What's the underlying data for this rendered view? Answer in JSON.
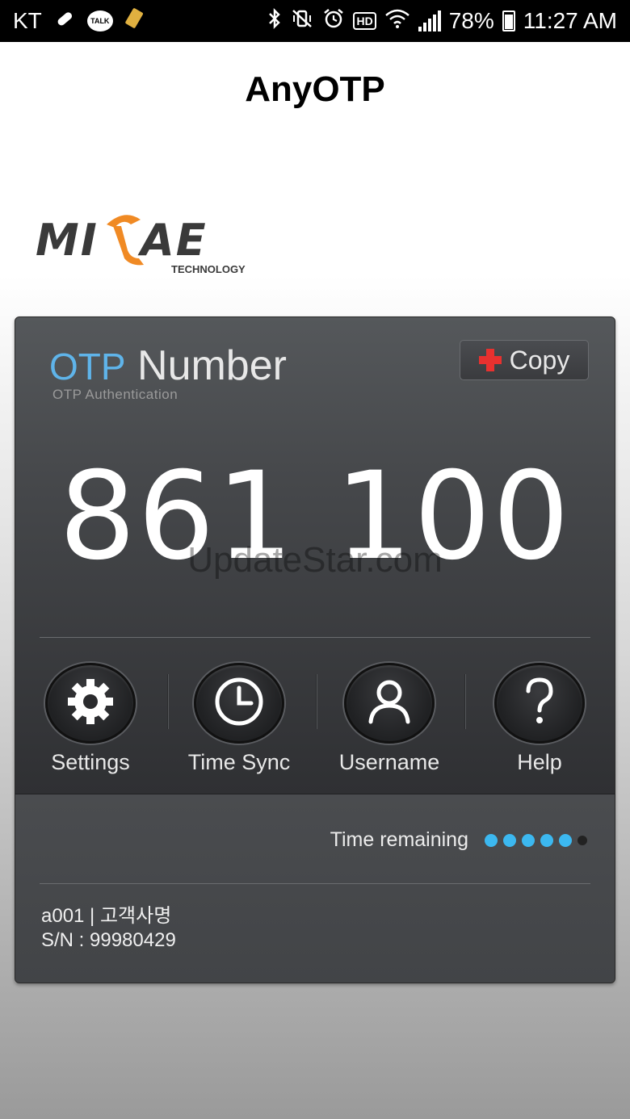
{
  "status_bar": {
    "carrier": "KT",
    "left_icons": [
      "pill-icon",
      "kakaotalk-icon",
      "ticket-icon"
    ],
    "kakao_label": "TALK",
    "right_icons": [
      "bluetooth-icon",
      "vibrate-mute-icon",
      "alarm-icon",
      "hd-icon",
      "wifi-icon",
      "signal-icon",
      "battery-icon"
    ],
    "hd_label": "HD",
    "battery": "78%",
    "time": "11:27 AM"
  },
  "app": {
    "title": "AnyOTP"
  },
  "logo": {
    "text": "MIRAE",
    "subtext": "TECHNOLOGY",
    "accent_color": "#f08a24",
    "dark_color": "#3a3a3a"
  },
  "otp": {
    "title_prefix": "OTP",
    "title_main": "Number",
    "subtitle": "OTP Authentication",
    "copy_label": "Copy",
    "number": "861 100",
    "watermark": "UpdateStar.com"
  },
  "actions": [
    {
      "label": "Settings",
      "icon": "gear-icon"
    },
    {
      "label": "Time Sync",
      "icon": "clock-icon"
    },
    {
      "label": "Username",
      "icon": "user-icon"
    },
    {
      "label": "Help",
      "icon": "question-icon"
    }
  ],
  "timer": {
    "label": "Time remaining",
    "dots_total": 6,
    "dots_remaining": 5,
    "dot_color": "#3cb8f0"
  },
  "account": {
    "user_line": "a001 | 고객사명",
    "serial_line": "S/N : 99980429"
  }
}
